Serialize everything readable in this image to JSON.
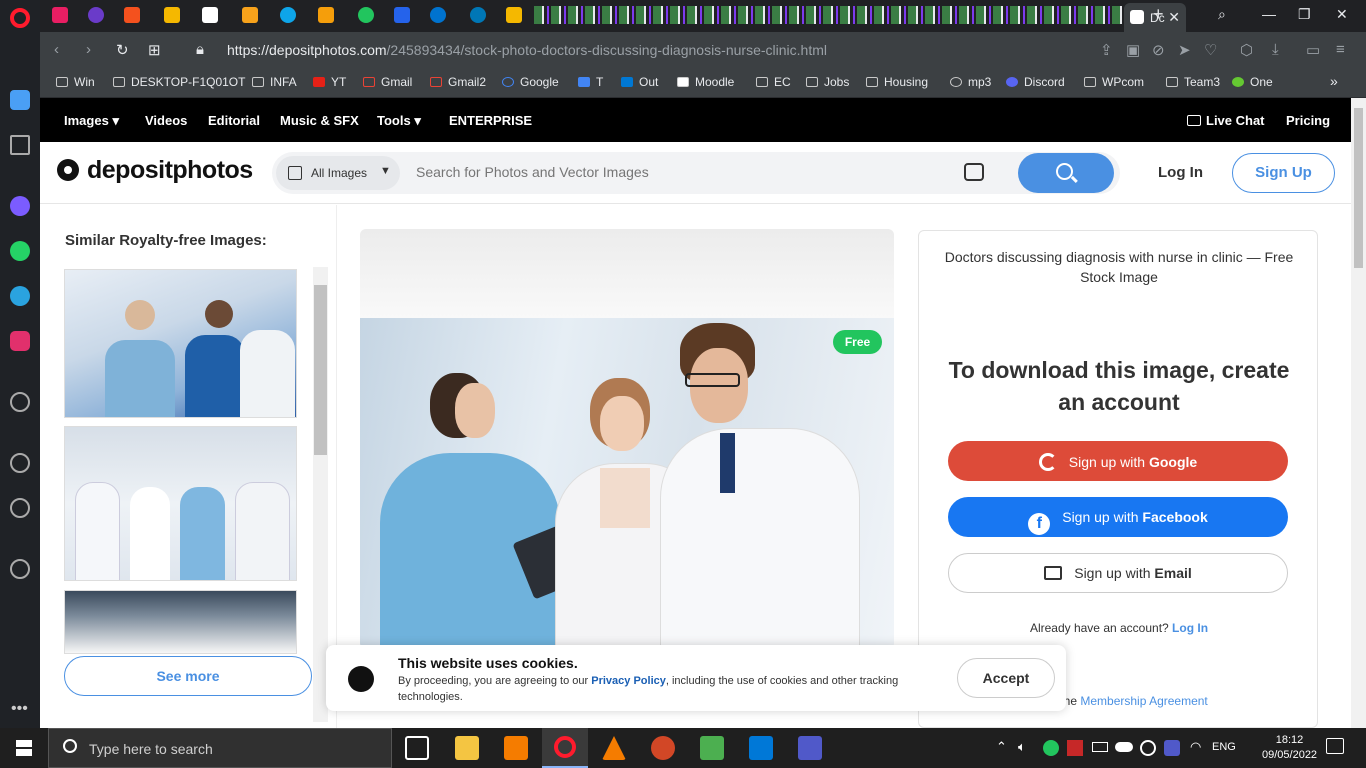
{
  "browser": {
    "active_tab_title": "Dc",
    "url_domain": "https://depositphotos.com",
    "url_path": "/245893434/stock-photo-doctors-discussing-diagnosis-nurse-clinic.html",
    "bookmarks": [
      "Win",
      "DESKTOP-F1Q01OT",
      "INFA",
      "YT",
      "Gmail",
      "Gmail2",
      "Google",
      "T",
      "Out",
      "Moodle",
      "EC",
      "Jobs",
      "Housing",
      "mp3",
      "Discord",
      "WPcom",
      "Team3",
      "One"
    ]
  },
  "site": {
    "nav": {
      "images": "Images",
      "videos": "Videos",
      "editorial": "Editorial",
      "music": "Music & SFX",
      "tools": "Tools",
      "enterprise": "ENTERPRISE",
      "live_chat": "Live Chat",
      "pricing": "Pricing"
    },
    "logo": "depositphotos",
    "search": {
      "category": "All Images",
      "placeholder": "Search for Photos and Vector Images"
    },
    "login": "Log In",
    "signup": "Sign Up",
    "similar_title": "Similar Royalty-free Images:",
    "see_more": "See more",
    "free_badge": "Free",
    "image_title": "Doctors discussing diagnosis with nurse in clinic — Free Stock Image",
    "download_heading": "To download this image, create an account",
    "google_btn_prefix": "Sign up with ",
    "google_btn_strong": "Google",
    "fb_btn_prefix": "Sign up with ",
    "fb_btn_strong": "Facebook",
    "email_btn_prefix": "Sign up with ",
    "email_btn_strong": "Email",
    "already_text": "Already have an account?",
    "already_link": "Log In",
    "membership_prefix": "e to the",
    "membership_link": "Membership Agreement"
  },
  "cookie": {
    "title": "This website uses cookies.",
    "text_before": "By proceeding, you are agreeing to our ",
    "link": "Privacy Policy",
    "text_after": ", including the use of cookies and other tracking technologies.",
    "accept": "Accept"
  },
  "taskbar": {
    "search_placeholder": "Type here to search",
    "lang": "ENG",
    "time": "18:12",
    "date": "09/05/2022"
  }
}
